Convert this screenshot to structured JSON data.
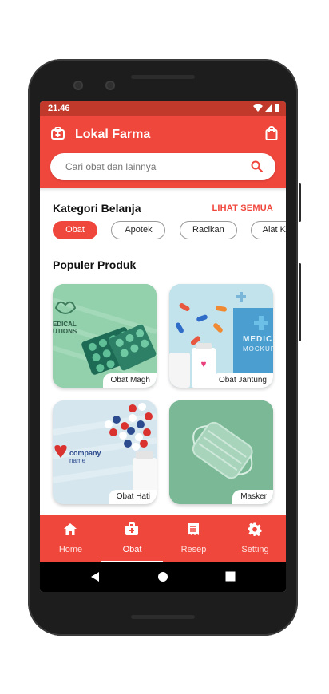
{
  "status": {
    "time": "21.46"
  },
  "header": {
    "title": "Lokal Farma",
    "search_placeholder": "Cari obat dan lainnya"
  },
  "categories": {
    "title": "Kategori Belanja",
    "see_all": "LIHAT SEMUA",
    "chips": [
      "Obat",
      "Apotek",
      "Racikan",
      "Alat Ke"
    ]
  },
  "popular": {
    "title": "Populer Produk",
    "products": [
      {
        "label": "Obat Magh",
        "image_text": [
          "EDICAL",
          "UTIONS"
        ]
      },
      {
        "label": "Obat Jantung",
        "image_text": [
          "MEDIC",
          "MOCKUP"
        ]
      },
      {
        "label": "Obat Hati",
        "image_text": [
          "company",
          "name"
        ]
      },
      {
        "label": "Masker"
      }
    ]
  },
  "bottom_nav": [
    {
      "label": "Home",
      "icon": "home-icon"
    },
    {
      "label": "Obat",
      "icon": "medkit-icon"
    },
    {
      "label": "Resep",
      "icon": "receipt-icon"
    },
    {
      "label": "Setting",
      "icon": "gear-icon"
    }
  ],
  "colors": {
    "primary": "#f0473d",
    "status_bar": "#c0392b"
  }
}
